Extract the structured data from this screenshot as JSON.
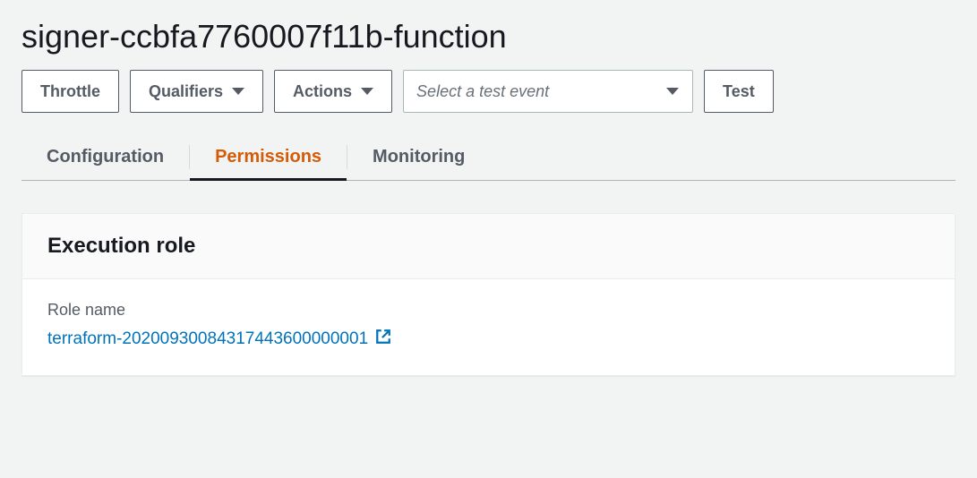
{
  "header": {
    "title": "signer-ccbfa7760007f11b-function"
  },
  "toolbar": {
    "throttle_label": "Throttle",
    "qualifiers_label": "Qualifiers",
    "actions_label": "Actions",
    "test_event_placeholder": "Select a test event",
    "test_label": "Test"
  },
  "tabs": [
    {
      "label": "Configuration",
      "active": false
    },
    {
      "label": "Permissions",
      "active": true
    },
    {
      "label": "Monitoring",
      "active": false
    }
  ],
  "panel": {
    "title": "Execution role",
    "role_name_label": "Role name",
    "role_name_value": "terraform-20200930084317443600000001"
  }
}
